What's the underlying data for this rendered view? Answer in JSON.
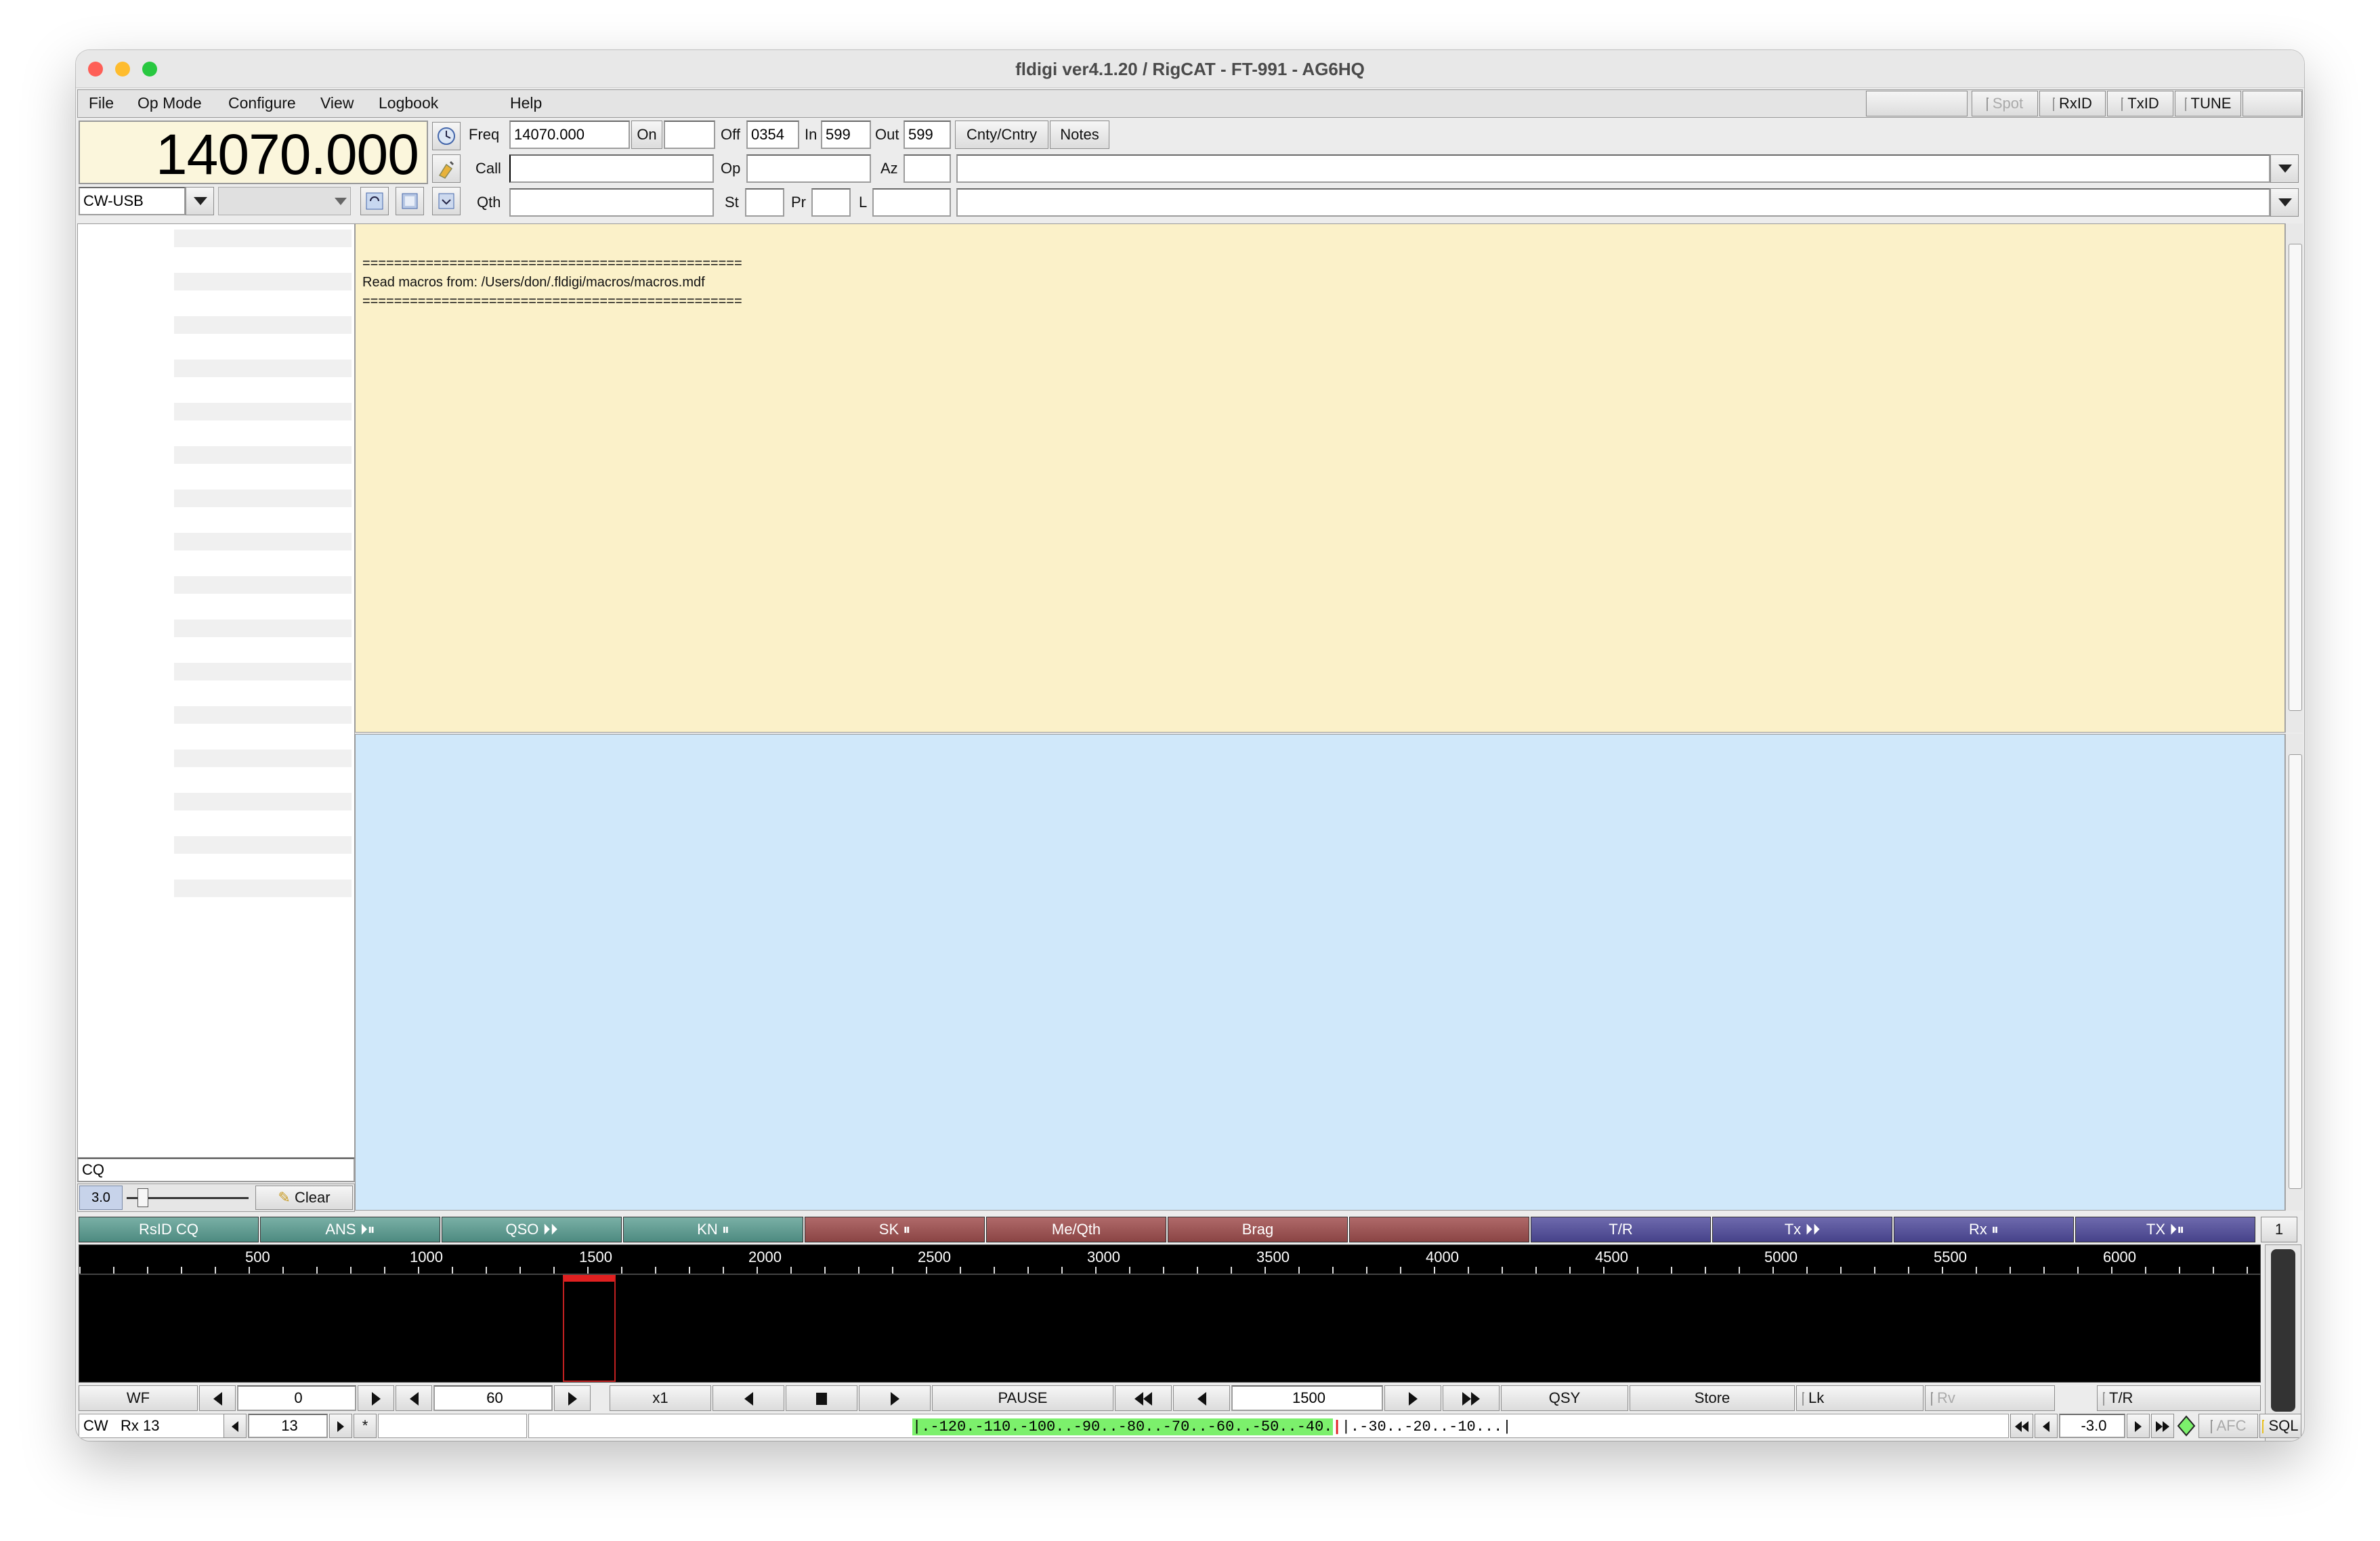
{
  "window": {
    "title": "fldigi ver4.1.20 / RigCAT - FT-991 - AG6HQ"
  },
  "colors": {
    "close": "#fe5f57",
    "minimize": "#febc2e",
    "zoom": "#28c840",
    "rx_pane": "#fbf1c9",
    "tx_pane": "#d0e8fa",
    "waterfall": "#000000",
    "macro_green": "#5e9a90",
    "macro_red": "#9a5454",
    "macro_blue": "#56529a",
    "signal_green": "#7cf06c",
    "marker_red": "#e02020"
  },
  "menu": [
    "File",
    "Op Mode",
    "Configure",
    "View",
    "Logbook",
    "Help"
  ],
  "top_right": {
    "spot": "Spot",
    "rxid": "RxID",
    "txid": "TxID",
    "tune": "TUNE"
  },
  "freq_display": "14070.000",
  "mode_select": "CW-USB",
  "log": {
    "freq_label": "Freq",
    "freq_value": "14070.000",
    "on_label": "On",
    "on_value": "",
    "off_label": "Off",
    "off_value": "0354",
    "in_label": "In",
    "in_value": "599",
    "out_label": "Out",
    "out_value": "599",
    "cnty_button": "Cnty/Cntry",
    "notes_button": "Notes",
    "call_label": "Call",
    "call_value": "",
    "op_label": "Op",
    "op_value": "",
    "az_label": "Az",
    "az_value": "",
    "qth_label": "Qth",
    "qth_value": "",
    "st_label": "St",
    "st_value": "",
    "pr_label": "Pr",
    "pr_value": "",
    "l_label": "L",
    "l_value": ""
  },
  "rx_text": {
    "line1": "================================================",
    "line2": "Read macros from: /Users/don/.fldigi/macros/macros.mdf",
    "line3": "================================================"
  },
  "browser": {
    "search_value": "CQ",
    "squelch_value": "3.0",
    "clear_label": "Clear"
  },
  "macros": [
    "RsID CQ",
    "ANS ⏵⏸",
    "QSO ⏵⏵",
    "KN ⏸",
    "SK ⏸",
    "Me/Qth",
    "Brag",
    "",
    "T/R",
    "Tx ⏵⏵",
    "Rx ⏸",
    "TX ⏵⏸"
  ],
  "macro_bank": "1",
  "ruler": [
    "500",
    "1000",
    "1500",
    "2000",
    "2500",
    "3000",
    "3500",
    "4000",
    "4500",
    "5000",
    "5500",
    "6000"
  ],
  "wf_controls": {
    "wf": "WF",
    "offset": "0",
    "speed": "60",
    "zoom": "x1",
    "pause": "PAUSE",
    "carrier": "1500",
    "qsy": "QSY",
    "store": "Store",
    "lk": "Lk",
    "rv": "Rv",
    "tr": "T/R"
  },
  "status": {
    "mode": "CW",
    "rx": "Rx 13",
    "wpm": "13",
    "star": "*",
    "scale": "|.-120.-110.-100..-90..-80..-70..-60..-50..-40.|.-30..-20..-10...|",
    "scale_active": "|.-120.-110.-100..-90..-80..-70..-60..-50..-40.",
    "scale_rest": "|.-30..-20..-10...|",
    "sql_level": "-3.0",
    "afc": "AFC",
    "sql": "SQL"
  }
}
